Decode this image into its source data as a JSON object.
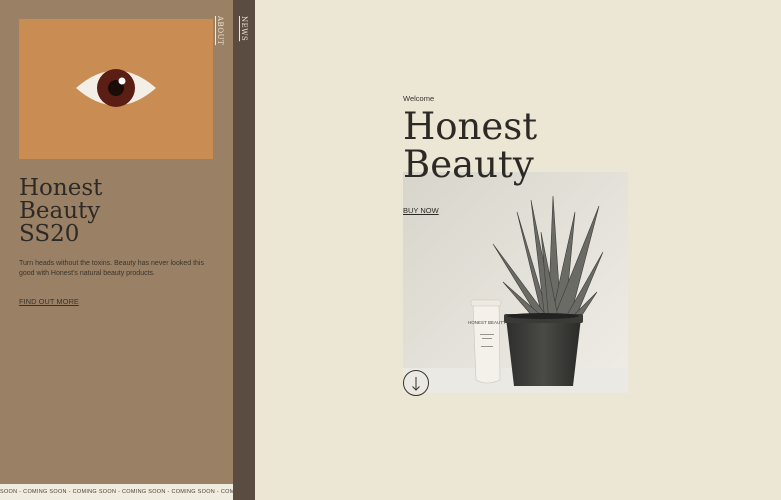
{
  "nav": {
    "about_label": "ABOUT",
    "news_label": "NEWS"
  },
  "left_panel": {
    "title_lines": [
      "Honest",
      "Beauty",
      "SS20"
    ],
    "description": "Turn heads without the toxins. Beauty has never looked this good with Honest's natural beauty products.",
    "link_label": "FIND OUT MORE",
    "card_icon": "eye-icon",
    "colors": {
      "panel": "#9a8166",
      "card": "#c98c52",
      "strip": "#5a4c40"
    }
  },
  "ticker": {
    "text": "SOON - COMING SOON - COMING SOON - COMING SOON - COMING SOON - COMING SOON - COMING SOON - C"
  },
  "hero": {
    "eyebrow": "Welcome",
    "title_lines": [
      "Honest",
      "Beauty"
    ],
    "cta_label": "BUY NOW",
    "scroll_icon": "arrow-down-icon",
    "product_tube_text": "HONEST BEAUTY",
    "background": "#ece6d4"
  }
}
